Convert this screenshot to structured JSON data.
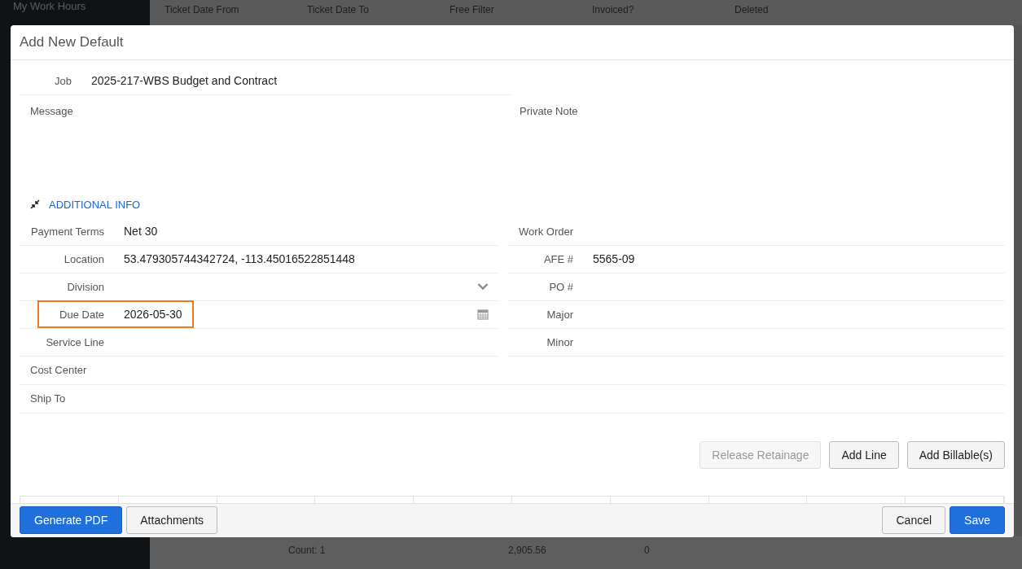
{
  "background": {
    "sidebar_title": "My Work Hours",
    "filters": [
      "Ticket Date From",
      "Ticket Date To",
      "Free Filter",
      "Invoiced?",
      "Deleted"
    ],
    "summary_row": {
      "count": "Count: 1",
      "amount": "2,905.56",
      "column_3": "0"
    }
  },
  "dialog": {
    "title": "Add New Default",
    "job": {
      "label": "Job",
      "value": "2025-217-WBS Budget and Contract"
    },
    "notes": [
      {
        "label": "Message"
      },
      {
        "label": "Private Note"
      }
    ],
    "section": {
      "label": "ADDITIONAL INFO",
      "expanded": true
    },
    "left_fields": [
      {
        "label": "Payment Terms",
        "value": "Net 30",
        "kind": "text",
        "highlighted": false
      },
      {
        "label": "Location",
        "value": "53.479305744342724, -113.45016522851448",
        "kind": "text",
        "highlighted": false
      },
      {
        "label": "Division",
        "kind": "select",
        "highlighted": false
      },
      {
        "label": "Due Date",
        "value": "2026-05-30",
        "kind": "date",
        "highlighted": true
      },
      {
        "label": "Service Line",
        "kind": "text",
        "highlighted": false
      }
    ],
    "right_fields": [
      {
        "label": "Work Order"
      },
      {
        "label": "AFE #",
        "value": "5565-09"
      },
      {
        "label": "PO #"
      },
      {
        "label": "Major"
      },
      {
        "label": "Minor"
      }
    ],
    "wide_fields": [
      {
        "label": "Cost Center"
      },
      {
        "label": "Ship To"
      }
    ],
    "actions": [
      {
        "label": "Release Retainage",
        "disabled": true
      },
      {
        "label": "Add Line",
        "disabled": false
      },
      {
        "label": "Add Billable(s)",
        "disabled": false
      }
    ],
    "footer_left": [
      {
        "label": "Generate PDF",
        "primary": true
      },
      {
        "label": "Attachments",
        "primary": false
      }
    ],
    "footer_right": [
      {
        "label": "Cancel",
        "primary": false
      },
      {
        "label": "Save",
        "primary": true
      }
    ]
  }
}
